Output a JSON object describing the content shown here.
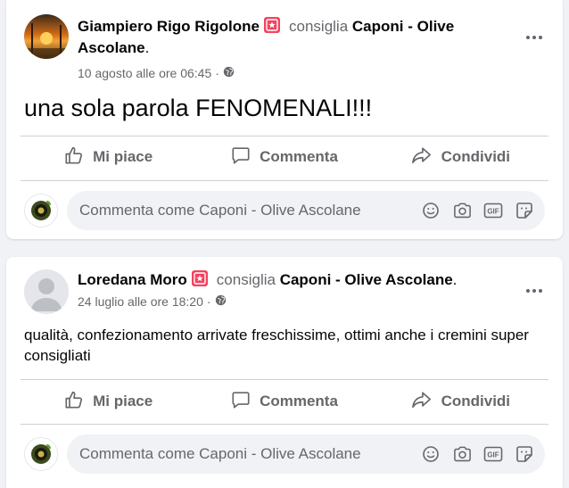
{
  "posts": [
    {
      "author": "Giampiero Rigo Rigolone",
      "verb": "consiglia",
      "page": "Caponi - Olive Ascolane",
      "end": ".",
      "date": "10 agosto alle ore 06:45",
      "separator": "·",
      "text": "una sola parola FENOMENALI!!!",
      "actions": {
        "like": "Mi piace",
        "comment": "Commenta",
        "share": "Condividi"
      },
      "comment_placeholder": "Commenta come Caponi - Olive Ascolane"
    },
    {
      "author": "Loredana Moro",
      "verb": "consiglia",
      "page": "Caponi - Olive Ascolane",
      "end": ".",
      "date": "24 luglio alle ore 18:20",
      "separator": "·",
      "text": "qualità,  confezionamento arrivate freschissime, ottimi anche i cremini super consigliati",
      "actions": {
        "like": "Mi piace",
        "comment": "Commenta",
        "share": "Condividi"
      },
      "comment_placeholder": "Commenta come Caponi - Olive Ascolane"
    }
  ],
  "icons": {
    "badge": "recommend-star-icon",
    "privacy": "globe-icon",
    "more": "more-options-icon",
    "like": "thumbs-up-icon",
    "comment": "comment-bubble-icon",
    "share": "share-arrow-icon",
    "emoji": "emoji-icon",
    "camera": "camera-icon",
    "gif": "gif-icon",
    "sticker": "sticker-icon"
  },
  "colors": {
    "badge": "#f3425f",
    "secondary_text": "#65676b",
    "page_background": "#f0f2f5"
  }
}
